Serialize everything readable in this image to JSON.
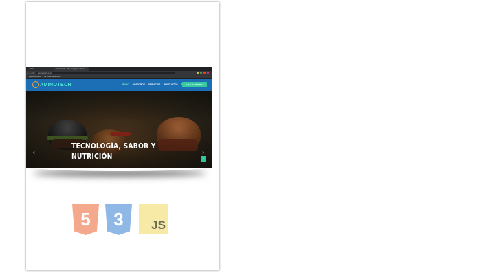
{
  "browser": {
    "tabs": [
      "Inicio",
      "aminotech – Tecnología, sabor y"
    ],
    "url": "aminotech.com",
    "bookmarks": [
      "Aplicaciones",
      "Mi Lista de lectura"
    ]
  },
  "site": {
    "logo_text": "AMINOTECH",
    "menu": [
      "INICIO",
      "NOSOTROS",
      "SERVICIOS",
      "PRODUCTOS",
      "CONTACTO"
    ],
    "cta_label": "HAZ TU PEDIDO",
    "hero_title": "TECNOLOGÍA, SABOR Y NUTRICIÓN",
    "prev_arrow": "‹",
    "next_arrow": "›",
    "scroll_top": "↑"
  },
  "tech_logos": {
    "html5": "5",
    "css3": "3",
    "js": "JS"
  },
  "colors": {
    "header_blue": "#1c6fb5",
    "accent_teal": "#38c9a1",
    "html5": "#f4a98d",
    "css3": "#8fb8e6",
    "js": "#f7eaa6"
  },
  "icons": [
    "html5-logo-icon",
    "css3-logo-icon",
    "javascript-logo-icon",
    "chevron-left-icon",
    "chevron-right-icon",
    "arrow-up-icon"
  ]
}
